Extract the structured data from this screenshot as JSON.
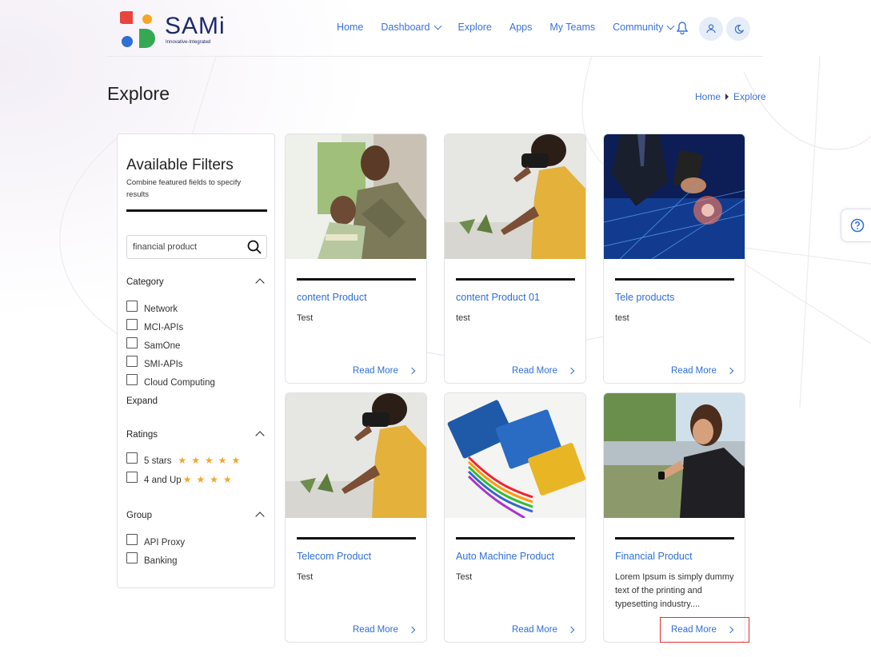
{
  "brand": {
    "name": "SAMi",
    "tagline": "Innovative-Integrated",
    "colors": {
      "red": "#e8453c",
      "orange": "#f5a623",
      "blue": "#2f6fd6",
      "green": "#34a853"
    }
  },
  "nav": {
    "items": [
      {
        "label": "Home"
      },
      {
        "label": "Dashboard",
        "has_dropdown": true
      },
      {
        "label": "Explore"
      },
      {
        "label": "Apps"
      },
      {
        "label": "My Teams"
      },
      {
        "label": "Community",
        "has_dropdown": true
      }
    ],
    "icons": [
      "bell-icon",
      "user-icon",
      "moon-icon"
    ]
  },
  "page": {
    "title": "Explore",
    "breadcrumb": [
      "Home",
      "Explore"
    ]
  },
  "filters": {
    "title": "Available Filters",
    "subtitle": "Combine featured fields to specify results",
    "search_value": "financial product",
    "sections": {
      "category": {
        "label": "Category",
        "options": [
          "Network",
          "MCI-APIs",
          "SamOne",
          "SMI-APIs",
          "Cloud Computing"
        ],
        "expand_label": "Expand"
      },
      "ratings": {
        "label": "Ratings",
        "options": [
          {
            "label": "5 stars",
            "stars": 5
          },
          {
            "label": "4 and Up",
            "stars": 4
          }
        ]
      },
      "group": {
        "label": "Group",
        "options": [
          "API Proxy",
          "Banking"
        ]
      }
    }
  },
  "cards": [
    {
      "title": "content Product",
      "desc": "Test",
      "more": "Read More",
      "image": "mother-hugging-child-photo"
    },
    {
      "title": "content Product 01",
      "desc": "test",
      "more": "Read More",
      "image": "vr-headset-photo"
    },
    {
      "title": "Tele products",
      "desc": "test",
      "more": "Read More",
      "image": "business-tablet-network-photo"
    },
    {
      "title": "Telecom Product",
      "desc": "Test",
      "more": "Read More",
      "image": "vr-headset-photo"
    },
    {
      "title": "Auto Machine Product",
      "desc": "Test",
      "more": "Read More",
      "image": "circuit-boards-photo"
    },
    {
      "title": "Financial Product",
      "desc": "Lorem Ipsum is simply dummy text of the printing and typesetting industry....",
      "more": "Read More",
      "image": "woman-smartwatch-photo"
    }
  ],
  "accent": "#2f6fd6",
  "star_color": "#f4a62a"
}
